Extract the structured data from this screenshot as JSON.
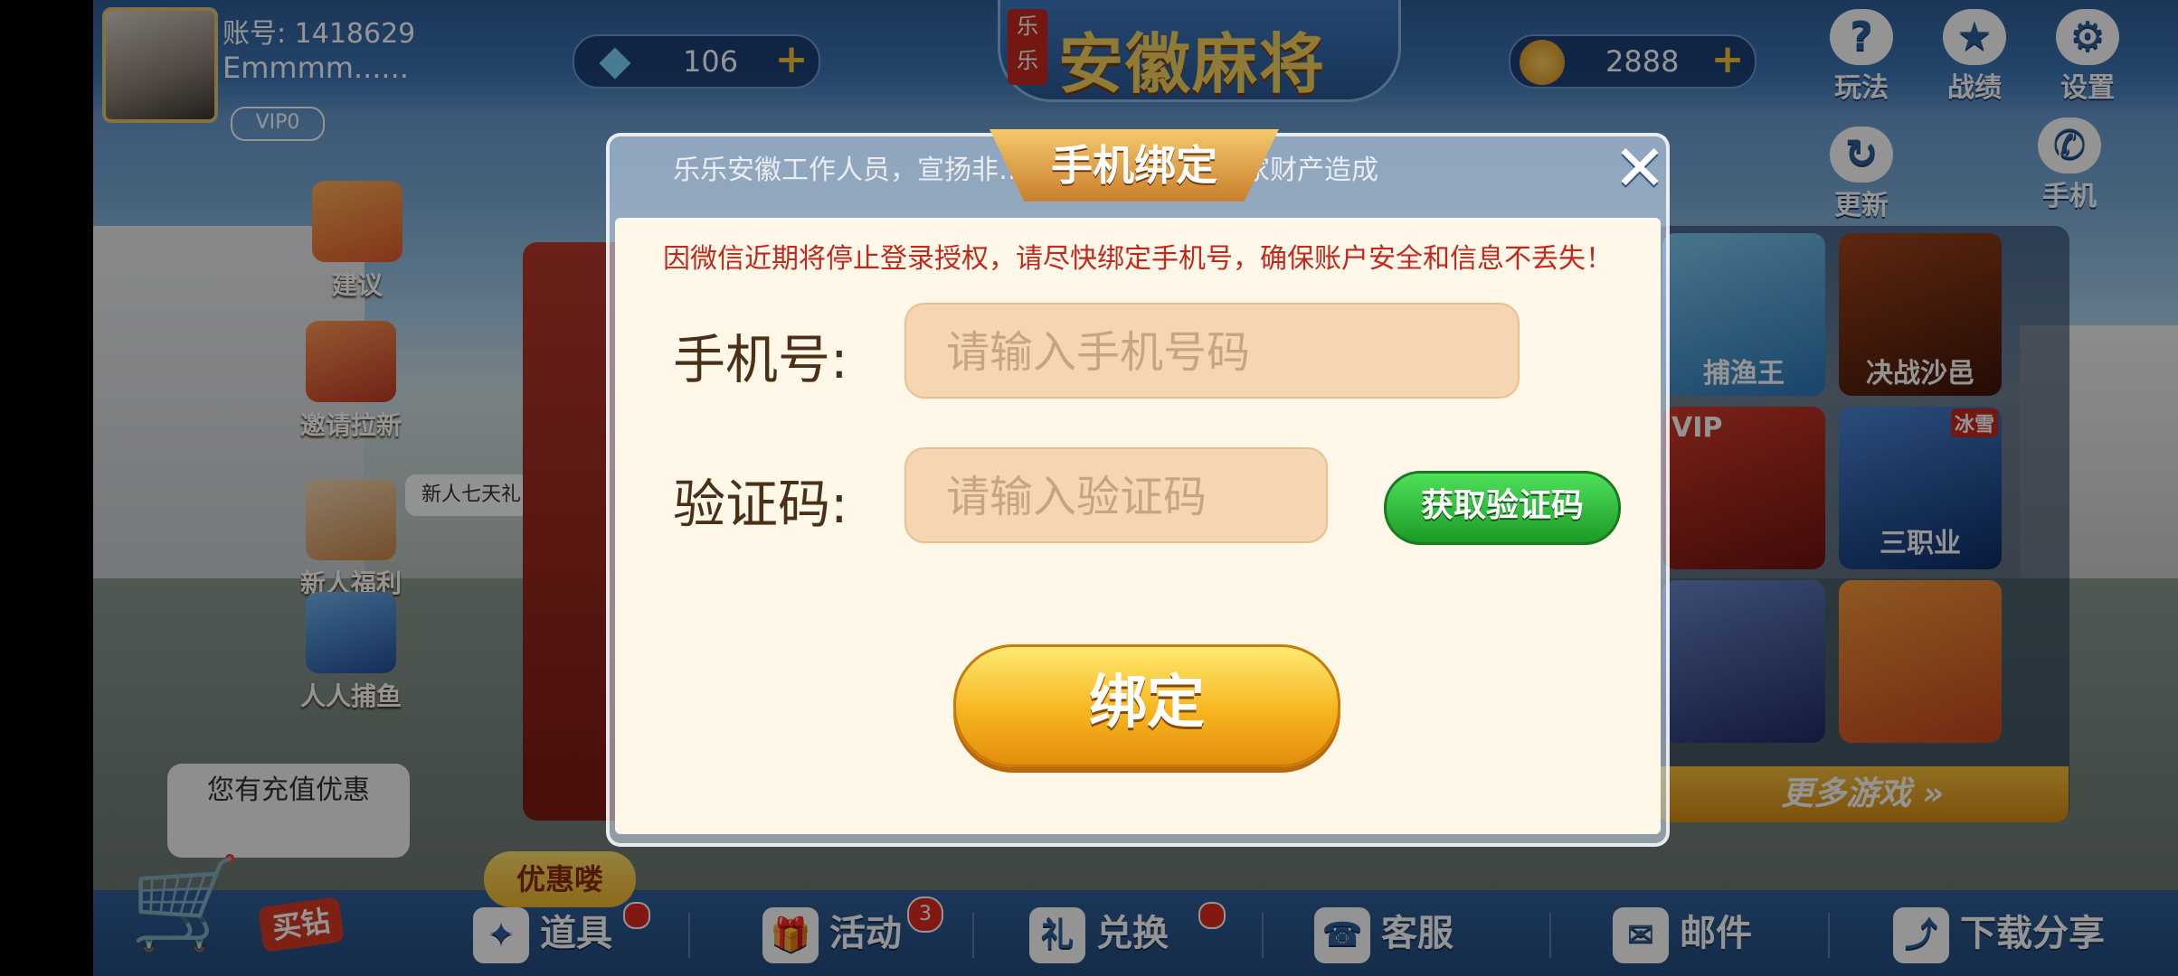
{
  "header": {
    "account_label": "账号: 1418629",
    "nickname": "Emmmm......",
    "vip": "VIP0",
    "diamonds": "106",
    "coins": "2888",
    "logo_seal": "乐乐",
    "logo_title": "安徽麻将",
    "help": "玩法",
    "record": "战绩",
    "settings": "设置",
    "update": "更新",
    "phone": "手机"
  },
  "sidebar": {
    "suggest": "建议",
    "invite": "邀请拉新",
    "newbie_welfare": "新人福利",
    "newbie_bubble": "新人七天礼",
    "fishing": "人人捕鱼",
    "recharge_bubble": "您有充值优惠"
  },
  "games": {
    "tile1": "捕渔王",
    "tile2": "决战沙邑",
    "tile3": "VIP",
    "tile4": "三职业",
    "tile4_tag": "冰雪",
    "more": "更多游戏 »"
  },
  "bottom": {
    "buy": "买钻",
    "promo": "优惠喽",
    "items": "道具",
    "activity": "活动",
    "activity_badge": "3",
    "exchange": "兑换",
    "exchange_icon": "礼",
    "service": "客服",
    "mail": "邮件",
    "share": "下载分享"
  },
  "dialog": {
    "title": "手机绑定",
    "marquee": "乐乐安徽工作人员，宣扬非……播谣言等，对玩家财产造成",
    "notice": "因微信近期将停止登录授权，请尽快绑定手机号，确保账户安全和信息不丢失！",
    "phone_label": "手机号:",
    "phone_placeholder": "请输入手机号码",
    "code_label": "验证码:",
    "code_placeholder": "请输入验证码",
    "get_code": "获取验证码",
    "bind": "绑定",
    "close": "✕"
  },
  "colors": {
    "accent_gold": "#f6b51f",
    "notice_red": "#c1291c",
    "get_code_green": "#1c9a27"
  }
}
